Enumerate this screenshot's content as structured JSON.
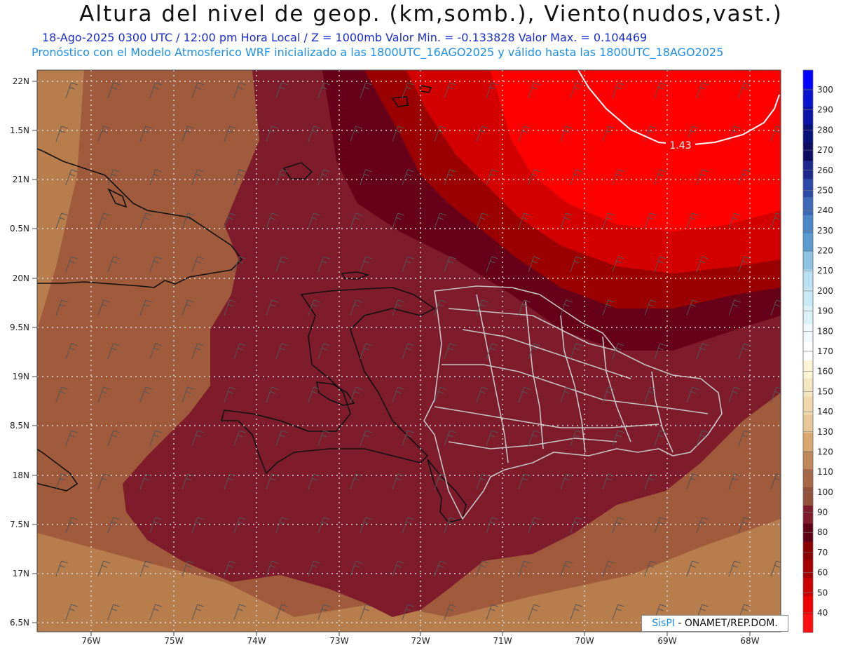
{
  "header": {
    "title": "Altura del nivel de geop. (km,somb.), Viento(nudos,vast.)",
    "subtitle_1": "18-Ago-2025 0300 UTC / 12:00 pm Hora Local / Z = 1000mb Valor Min. = -0.133828  Valor Max. = 0.104469",
    "subtitle_2": "Pronóstico con el Modelo Atmosferico WRF inicializado a las 1800UTC_16AGO2025 y válido hasta las  1800UTC_18AGO2025"
  },
  "map": {
    "lat_labels": [
      "22N",
      "1.5N",
      "21N",
      "0.5N",
      "20N",
      "9.5N",
      "19N",
      "8.5N",
      "18N",
      "7.5N",
      "17N",
      "6.5N"
    ],
    "lon_labels": [
      "76W",
      "75W",
      "74W",
      "73W",
      "72W",
      "71W",
      "70W",
      "69W",
      "68W"
    ],
    "contour_label": "1.43",
    "colors": {
      "light_brown": "#b87d4d",
      "brown": "#a05a3c",
      "maroon": "#7e1c2c",
      "dark_maroon": "#660018",
      "dark_red": "#9b0000",
      "red": "#d20000",
      "bright_red": "#ff0000"
    }
  },
  "colorbar": {
    "labels": [
      "300",
      "290",
      "280",
      "270",
      "260",
      "250",
      "240",
      "230",
      "220",
      "210",
      "200",
      "190",
      "180",
      "170",
      "160",
      "150",
      "140",
      "130",
      "120",
      "110",
      "100",
      "90",
      "80",
      "70",
      "60",
      "50",
      "40"
    ],
    "colors": [
      "#0000ff",
      "#0a14d0",
      "#0a14a8",
      "#08107a",
      "#0c0c60",
      "#1e2a8e",
      "#2e4aa8",
      "#3c6ab8",
      "#4c88c8",
      "#5a9cd0",
      "#8cc2e2",
      "#b8e0f0",
      "#c8e8f4",
      "#dcf0f8",
      "#f0f8fc",
      "#ffffff",
      "#fcf4d4",
      "#f4e6c0",
      "#eed8ac",
      "#e8c898",
      "#d8a870",
      "#c08858",
      "#a86848",
      "#94523c",
      "#7e1c2c",
      "#5e0014",
      "#8c0000",
      "#a80000",
      "#cc0000",
      "#ee0000",
      "#ff1010"
    ]
  },
  "credit": {
    "brand": "SisPI",
    "text": "- ONAMET/REP.DOM."
  }
}
